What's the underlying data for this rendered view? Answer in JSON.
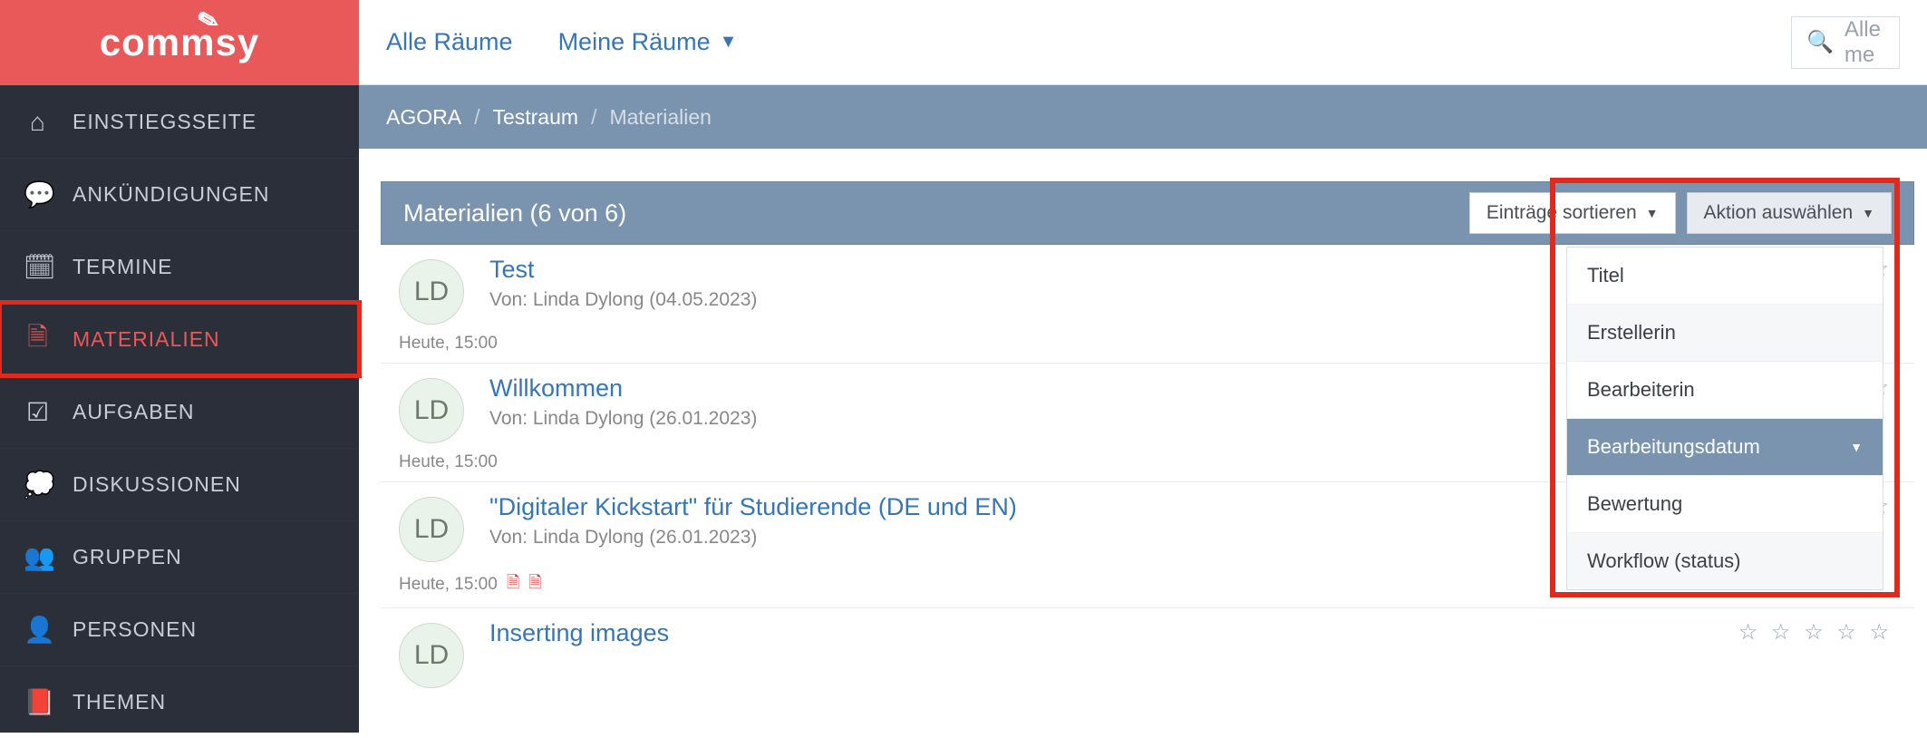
{
  "logo": {
    "text": "commsy",
    "decor": "✎"
  },
  "sidebar": {
    "items": [
      {
        "label": "EINSTIEGSSEITE",
        "icon": "home-icon",
        "glyph": "⌂"
      },
      {
        "label": "ANKÜNDIGUNGEN",
        "icon": "speech-icon",
        "glyph": "💬"
      },
      {
        "label": "TERMINE",
        "icon": "calendar-icon",
        "glyph": "🗓"
      },
      {
        "label": "MATERIALIEN",
        "icon": "file-icon",
        "glyph": "🗎",
        "active": true,
        "highlighted": true
      },
      {
        "label": "AUFGABEN",
        "icon": "check-icon",
        "glyph": "☑"
      },
      {
        "label": "DISKUSSIONEN",
        "icon": "discuss-icon",
        "glyph": "💭"
      },
      {
        "label": "GRUPPEN",
        "icon": "group-icon",
        "glyph": "👥"
      },
      {
        "label": "PERSONEN",
        "icon": "person-icon",
        "glyph": "👤"
      },
      {
        "label": "THEMEN",
        "icon": "book-icon",
        "glyph": "📕"
      }
    ]
  },
  "topbar": {
    "all_rooms": "Alle Räume",
    "my_rooms": "Meine Räume",
    "search_placeholder": "Alle me"
  },
  "breadcrumb": {
    "root": "AGORA",
    "room": "Testraum",
    "current": "Materialien",
    "sep": "/"
  },
  "panel": {
    "title": "Materialien (6 von 6)",
    "sort_label": "Einträge sortieren",
    "action_label": "Aktion auswählen"
  },
  "sort_options": [
    {
      "label": "Titel"
    },
    {
      "label": "Erstellerin"
    },
    {
      "label": "Bearbeiterin"
    },
    {
      "label": "Bearbeitungsdatum",
      "selected": true
    },
    {
      "label": "Bewertung"
    },
    {
      "label": "Workflow (status)"
    }
  ],
  "items": [
    {
      "avatar": "LD",
      "title": "Test",
      "meta": "Von: Linda Dylong (04.05.2023)",
      "footer": "Heute, 15:00",
      "attachments": []
    },
    {
      "avatar": "LD",
      "title": "Willkommen",
      "meta": "Von: Linda Dylong (26.01.2023)",
      "footer": "Heute, 15:00",
      "attachments": []
    },
    {
      "avatar": "LD",
      "title": "\"Digitaler Kickstart\" für Studierende (DE und EN)",
      "meta": "Von: Linda Dylong (26.01.2023)",
      "footer": "Heute, 15:00",
      "attachments": [
        "pdf",
        "pdf"
      ]
    },
    {
      "avatar": "LD",
      "title": "Inserting images",
      "meta": "",
      "footer": "",
      "attachments": []
    }
  ],
  "rating": {
    "stars": "☆ ☆ ☆ ☆ ☆",
    "circles": "○ ○ ○"
  }
}
